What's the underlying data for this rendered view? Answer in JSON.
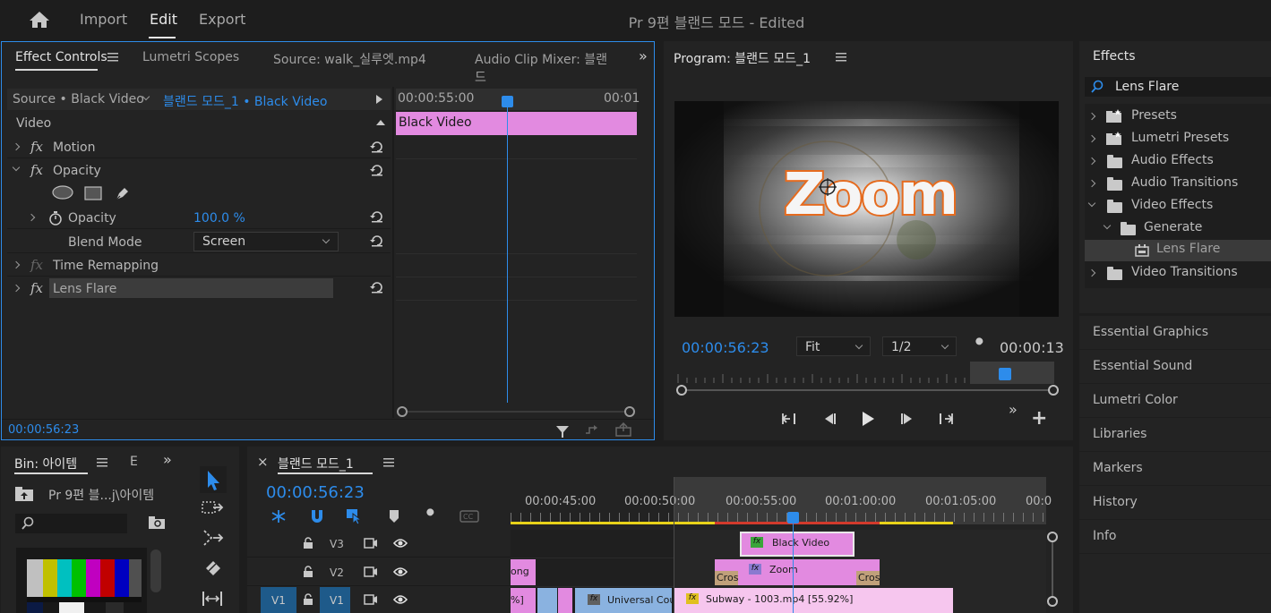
{
  "topbar": {
    "home_label": "",
    "nav": [
      "Import",
      "Edit",
      "Export"
    ],
    "title": "Pr 9편 블랜드 모드",
    "title_suffix": " - Edited"
  },
  "effect_controls": {
    "tabs": [
      "Effect Controls",
      "Lumetri Scopes",
      "Source:  walk_실루엣.mp4",
      "Audio Clip Mixer: 블랜드"
    ],
    "source_label": "Source • Black Video",
    "sequence_label": "블랜드 모드_1 • Black Video",
    "time_start": "00:00:55:00",
    "time_end": "00:01",
    "clip_label": "Black Video",
    "section_video": "Video",
    "effects": [
      "Motion",
      "Opacity",
      "Time Remapping",
      "Lens Flare"
    ],
    "opacity_label": "Opacity",
    "opacity_value": "100.0 %",
    "blend_label": "Blend Mode",
    "blend_value": "Screen",
    "timecode": "00:00:56:23"
  },
  "program": {
    "title": "Program: 블랜드 모드_1",
    "timecode": "00:00:56:23",
    "fit": "Fit",
    "resolution": "1/2",
    "duration": "00:00:13",
    "overlay_text": "Zoom"
  },
  "effects_panel": {
    "title": "Effects",
    "search_value": "Lens Flare",
    "items": [
      {
        "label": "Presets",
        "level": 0,
        "icon": "star-folder-icon",
        "expanded": false
      },
      {
        "label": "Lumetri Presets",
        "level": 0,
        "icon": "star-folder-icon",
        "expanded": false
      },
      {
        "label": "Audio Effects",
        "level": 0,
        "icon": "folder-icon",
        "expanded": false
      },
      {
        "label": "Audio Transitions",
        "level": 0,
        "icon": "folder-icon",
        "expanded": false
      },
      {
        "label": "Video Effects",
        "level": 0,
        "icon": "folder-icon",
        "expanded": true
      },
      {
        "label": "Generate",
        "level": 1,
        "icon": "folder-icon",
        "expanded": true
      },
      {
        "label": "Lens Flare",
        "level": 2,
        "icon": "effect-icon",
        "selected": true
      },
      {
        "label": "Video Transitions",
        "level": 0,
        "icon": "folder-icon",
        "expanded": false
      }
    ]
  },
  "side_panels": [
    "Essential Graphics",
    "Essential Sound",
    "Lumetri Color",
    "Libraries",
    "Markers",
    "History",
    "Info"
  ],
  "bin": {
    "title": "Bin: 아이템",
    "tab2": "E",
    "path": "Pr 9편 블...j\\아이템"
  },
  "timeline": {
    "title": "블랜드 모드_1",
    "timecode": "00:00:56:23",
    "ruler": [
      "00:00:45:00",
      "00:00:50:00",
      "00:00:55:00",
      "00:01:00:00",
      "00:01:05:00",
      "00:0"
    ],
    "tracks": [
      "V3",
      "V2",
      "V1"
    ],
    "source_track": "V1",
    "clips": {
      "v3_black": "Black Video",
      "v2_left": "ong",
      "v2_cross1": "Cros",
      "v2_zoom": "Zoom",
      "v2_cross2": "Cros",
      "v1_pct": "%]",
      "v1_universal": "Universal Cou",
      "v1_subway": "Subway - 1003.mp4 [55.92%]"
    }
  },
  "colors": {
    "accent": "#2d8ceb",
    "pink_clip": "#e28ae0",
    "light_pink_clip": "#f6c6ee",
    "blue_clip": "#8ab2e0"
  }
}
